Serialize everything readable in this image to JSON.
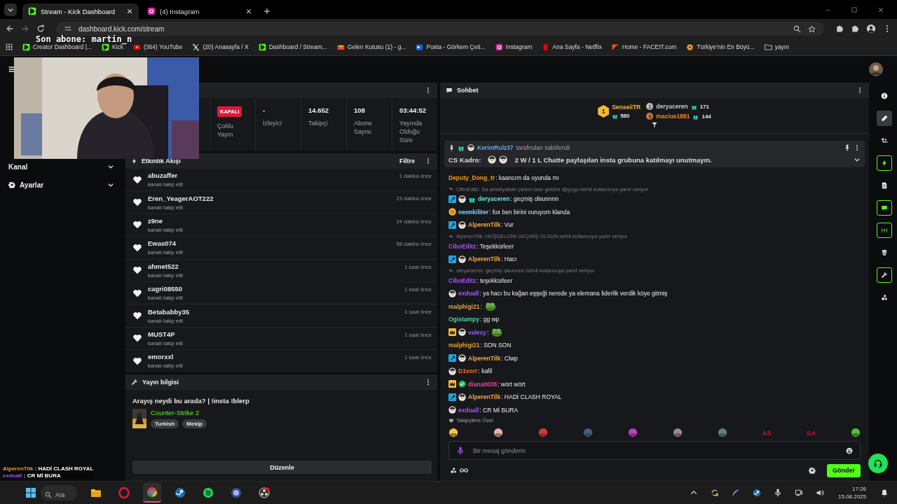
{
  "browser": {
    "tabs": [
      {
        "title": "Stream - Kick Dashboard",
        "kind": "kick",
        "selected": true
      },
      {
        "title": "(4) Instagram",
        "kind": "instagram",
        "selected": false
      }
    ],
    "url": "dashboard.kick.com/stream",
    "bookmarks": [
      {
        "label": "Creator Dashboard |...",
        "kind": "kick"
      },
      {
        "label": "Kick",
        "kind": "kick"
      },
      {
        "label": "(364) YouTube",
        "kind": "youtube"
      },
      {
        "label": "(20) Anasayfa / X",
        "kind": "x"
      },
      {
        "label": "Dashboard / Stream...",
        "kind": "kick"
      },
      {
        "label": "Gelen Kutusu (1) - g...",
        "kind": "gmail"
      },
      {
        "label": "Posta - Görkem Çeti...",
        "kind": "outlook"
      },
      {
        "label": "Instagram",
        "kind": "instagram"
      },
      {
        "label": "Ana Sayfa - Netflix",
        "kind": "netflix"
      },
      {
        "label": "Home - FACEIT.com",
        "kind": "faceit"
      },
      {
        "label": "Türkiye'nin En Büyü...",
        "kind": "site"
      },
      {
        "label": "yayın",
        "kind": "folder"
      }
    ]
  },
  "overlay": {
    "last_sub": "Son abone: martin_n",
    "chat": [
      {
        "user": "AlperenTilk",
        "color": "#e8a23a",
        "text": " : HADİ CLASH ROYAL"
      },
      {
        "user": "exduall",
        "color": "#a855f7",
        "text": " : CR Mİ BURA"
      }
    ]
  },
  "sidebar": [
    {
      "label": "Kanal",
      "kind": "plain",
      "expanded": false
    },
    {
      "label": "Ayarlar",
      "kind": "gear",
      "expanded": false
    }
  ],
  "stats": [
    {
      "value": "KAPALI",
      "label": "Çoklu Yayın",
      "kind": "badge"
    },
    {
      "value": "-",
      "label": "İzleyici",
      "kind": "number"
    },
    {
      "value": "14.652",
      "label": "Takipçi",
      "kind": "number"
    },
    {
      "value": "108",
      "label": "Abone Sayısı",
      "kind": "number"
    },
    {
      "value": "03:44:52",
      "label": "Yayında Olduğu Süre",
      "kind": "number"
    }
  ],
  "activity": {
    "title": "Etkinlik Akışı",
    "filter": "Filtre",
    "items": [
      {
        "user": "abuzaffer",
        "action": "kanalı takip etti",
        "time": "1 dakika önce"
      },
      {
        "user": "Eren_YeagerAOT222",
        "action": "kanalı takip etti",
        "time": "23 dakika önce"
      },
      {
        "user": "z9ne",
        "action": "kanalı takip etti",
        "time": "24 dakika önce"
      },
      {
        "user": "Ewas074",
        "action": "kanalı takip etti",
        "time": "58 dakika önce"
      },
      {
        "user": "ahmet522",
        "action": "kanalı takip etti",
        "time": "1 saat önce"
      },
      {
        "user": "cagri08550",
        "action": "kanalı takip etti",
        "time": "1 saat önce"
      },
      {
        "user": "Betababby35",
        "action": "kanalı takip etti",
        "time": "1 saat önce"
      },
      {
        "user": "MUST4P",
        "action": "kanalı takip etti",
        "time": "1 saat önce"
      },
      {
        "user": "emorxxl",
        "action": "kanalı takip etti",
        "time": "1 saat önce"
      }
    ]
  },
  "stream_info": {
    "title": "Yayın bilgisi",
    "stream_title": "Arayış neydi bu arada? | !insta !blerp",
    "game": "Counter-Strike 2",
    "tags": [
      "Turkish",
      "Mekip"
    ],
    "edit_button": "Düzenle"
  },
  "chat": {
    "title": "Sohbet",
    "leaderboard": [
      {
        "rank": "1",
        "user": "SenseiiTR",
        "gifts": "580",
        "color": "#f5b83d"
      },
      {
        "rank": "2",
        "user": "deryaceren",
        "gifts": "171",
        "color": "#c9c9c9"
      },
      {
        "rank": "3",
        "user": "macius1881",
        "gifts": "144",
        "color": "#f08a24"
      }
    ],
    "pinned": {
      "user": "KerimRulz37",
      "note": "tarafından sabitlendi",
      "prefix": "CS Kadro:",
      "text": "2 W / 1 L Chatte paylaşılan insta grubuna katılmayı unutmayın."
    },
    "messages": [
      {
        "user": "Deputy_Dong_tr",
        "color": "#f59e0b",
        "text": ": kaancım da oyunda mı",
        "kind": "text"
      },
      {
        "reply": "CiboEditz: Sa ameliyattan çıktım taze geldim @gogo isimli kullanıcıya yanıt veriyor",
        "badges": [
          {
            "kind": "mod"
          },
          {
            "kind": "avatar"
          },
          {
            "kind": "gift"
          }
        ],
        "user": "deryaceren",
        "color": "#5eead4",
        "text": ": geçmiş olsunnnn",
        "kind": "text"
      },
      {
        "badges": [
          {
            "kind": "sub"
          }
        ],
        "user": "neonkiliter",
        "color": "#7dd3fc",
        "text": ": fox ben birini vuruyom klanda",
        "kind": "text"
      },
      {
        "badges": [
          {
            "kind": "mod"
          },
          {
            "kind": "avatar"
          }
        ],
        "user": "AlperenTilk",
        "color": "#f0a94a",
        "text": ": Vur",
        "kind": "text"
      },
      {
        "reply": "AlperenTilk: HOŞGELDİN GEÇMİŞ OLSUN isimli kullanıcıya yanıt veriyor",
        "user": "CiboEditz",
        "color": "#a855f7",
        "text": ": Teşekkürleer",
        "kind": "text"
      },
      {
        "badges": [
          {
            "kind": "mod"
          },
          {
            "kind": "avatar"
          }
        ],
        "user": "AlperenTilk",
        "color": "#f0a94a",
        "text": ": Hacı",
        "kind": "text"
      },
      {
        "reply": "deryaceren: geçmiş olsunnnn isimli kullanıcıya yanıt veriyor",
        "user": "CiboEditz",
        "color": "#a855f7",
        "text": ": teşekkürleer",
        "kind": "text"
      },
      {
        "badges": [
          {
            "kind": "avatar"
          }
        ],
        "user": "exduall",
        "color": "#a855f7",
        "text": ": ya hacı bu kağan eşşeği nerede ya elemana liderlik verdik köye gitmiş",
        "kind": "text"
      },
      {
        "user": "malphigi21",
        "color": "#e8a23a",
        "text": ":",
        "kind": "emote"
      },
      {
        "user": "Ogistampy",
        "color": "#4fd1a5",
        "text": ": gg wp",
        "kind": "text"
      },
      {
        "badges": [
          {
            "kind": "crown"
          },
          {
            "kind": "avatar"
          }
        ],
        "user": "valesy",
        "color": "#8b5cf6",
        "text": ":",
        "kind": "emote"
      },
      {
        "user": "malphigi21",
        "color": "#e8a23a",
        "text": ": SON SON",
        "kind": "text"
      },
      {
        "badges": [
          {
            "kind": "mod"
          },
          {
            "kind": "avatar"
          }
        ],
        "user": "AlperenTilk",
        "color": "#f0a94a",
        "text": ": Clwp",
        "kind": "text"
      },
      {
        "badges": [
          {
            "kind": "avatar"
          }
        ],
        "user": "D1vorr",
        "color": "#f97316",
        "text": ": kafil",
        "kind": "text"
      },
      {
        "badges": [
          {
            "kind": "crown"
          },
          {
            "kind": "verified"
          }
        ],
        "user": "diana0035",
        "color": "#ec4899",
        "text": ": wört wört",
        "kind": "text"
      },
      {
        "badges": [
          {
            "kind": "mod"
          },
          {
            "kind": "avatar"
          }
        ],
        "user": "AlperenTilk",
        "color": "#f0a94a",
        "text": ": HADİ CLASH ROYAL",
        "kind": "text"
      },
      {
        "badges": [
          {
            "kind": "avatar"
          }
        ],
        "user": "exduall",
        "color": "#a855f7",
        "text": ": CR Mİ BURA",
        "kind": "text"
      }
    ],
    "emote_label": "Takipçilere Özel",
    "emotes": [
      {
        "kind": "emote",
        "color": "#f5c542"
      },
      {
        "kind": "emote",
        "color": "#e8b0a8"
      },
      {
        "kind": "emote",
        "color": "#d83a3a"
      },
      {
        "kind": "emote",
        "color": "#4a5a8a"
      },
      {
        "kind": "emote",
        "color": "#c040c0"
      },
      {
        "kind": "emote",
        "color": "#9a8a8a"
      },
      {
        "kind": "emote",
        "color": "#5a8a6a"
      },
      {
        "kind": "text",
        "text": "AS"
      },
      {
        "kind": "text",
        "text": "SA"
      },
      {
        "kind": "emote",
        "color": "#55c030"
      }
    ],
    "input_placeholder": "Bir mesaj gönderin",
    "send_button": "Gönder"
  },
  "rail": [
    {
      "kind": "info",
      "on": false,
      "selected": false
    },
    {
      "kind": "pencil",
      "on": false,
      "selected": true
    },
    {
      "kind": "crop",
      "on": false,
      "selected": false
    },
    {
      "kind": "bolt",
      "on": true,
      "selected": false
    },
    {
      "kind": "doc",
      "on": false,
      "selected": false
    },
    {
      "kind": "chat",
      "on": true,
      "selected": false
    },
    {
      "kind": "broadcast",
      "on": true,
      "selected": false
    },
    {
      "kind": "layers",
      "on": false,
      "selected": false
    },
    {
      "kind": "wrench",
      "on": true,
      "selected": false
    },
    {
      "kind": "dots",
      "on": false,
      "selected": false
    }
  ],
  "taskbar": {
    "search": "Ara",
    "apps": [
      {
        "kind": "files",
        "active": false
      },
      {
        "kind": "opera",
        "active": false
      },
      {
        "kind": "chrome",
        "active": true
      },
      {
        "kind": "steam",
        "active": false
      },
      {
        "kind": "spotify",
        "active": false
      },
      {
        "kind": "app",
        "active": false
      },
      {
        "kind": "obs",
        "active": false
      }
    ],
    "tray": [
      {
        "kind": "up"
      },
      {
        "kind": "sync"
      },
      {
        "kind": "feather"
      },
      {
        "kind": "steam"
      },
      {
        "kind": "mic"
      },
      {
        "kind": "network"
      },
      {
        "kind": "volume"
      }
    ],
    "time": "17:26",
    "date": "15.08.2025"
  }
}
